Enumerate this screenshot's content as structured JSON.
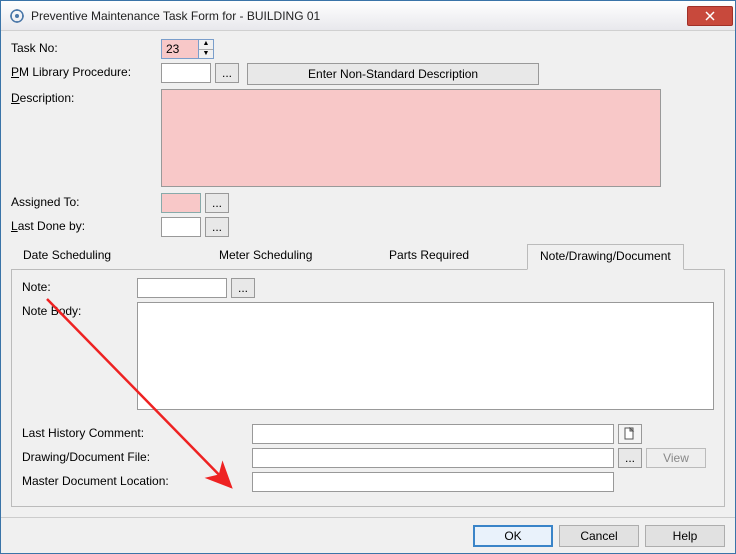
{
  "window": {
    "title": "Preventive Maintenance Task Form for - BUILDING 01"
  },
  "fields": {
    "taskno_label": "Task No:",
    "taskno_value": "23",
    "pmlib_label_pre": "P",
    "pmlib_label_rest": "M Library Procedure:",
    "pmlib_value": "",
    "nonstd_btn": "Enter Non-Standard Description",
    "nonstd_u": "E",
    "desc_label": "Description:",
    "desc_label_u": "D",
    "desc_value": "",
    "assigned_label": "Assigned To:",
    "assigned_value": "",
    "lastdone_label_pre": "L",
    "lastdone_label_rest": "ast Done by:",
    "lastdone_value": ""
  },
  "tabs": {
    "t1": "Date Scheduling",
    "t1_u_idx": 0,
    "t2": "Meter Scheduling",
    "t2_u": "M",
    "t3": "Parts Required",
    "t3_u": "P",
    "t4": "Note/Drawing/Document"
  },
  "panel": {
    "note_label": "Note:",
    "note_value": "",
    "notebody_label_u": "N",
    "notebody_label_rest": "ote Body:",
    "notebody_value": "",
    "lasthist_label_pre": "Last ",
    "lasthist_label_u": "H",
    "lasthist_label_post": "istory Comment:",
    "lasthist_value": "",
    "drawfile_label": "Drawing/Document File:",
    "drawfile_value": "",
    "master_label": "Master Document Location:",
    "master_value": "",
    "view_btn_u": "V",
    "view_btn_rest": "iew"
  },
  "footer": {
    "ok": "OK",
    "cancel_u": "C",
    "cancel_rest": "ancel",
    "help_u": "H",
    "help_rest": "elp"
  }
}
